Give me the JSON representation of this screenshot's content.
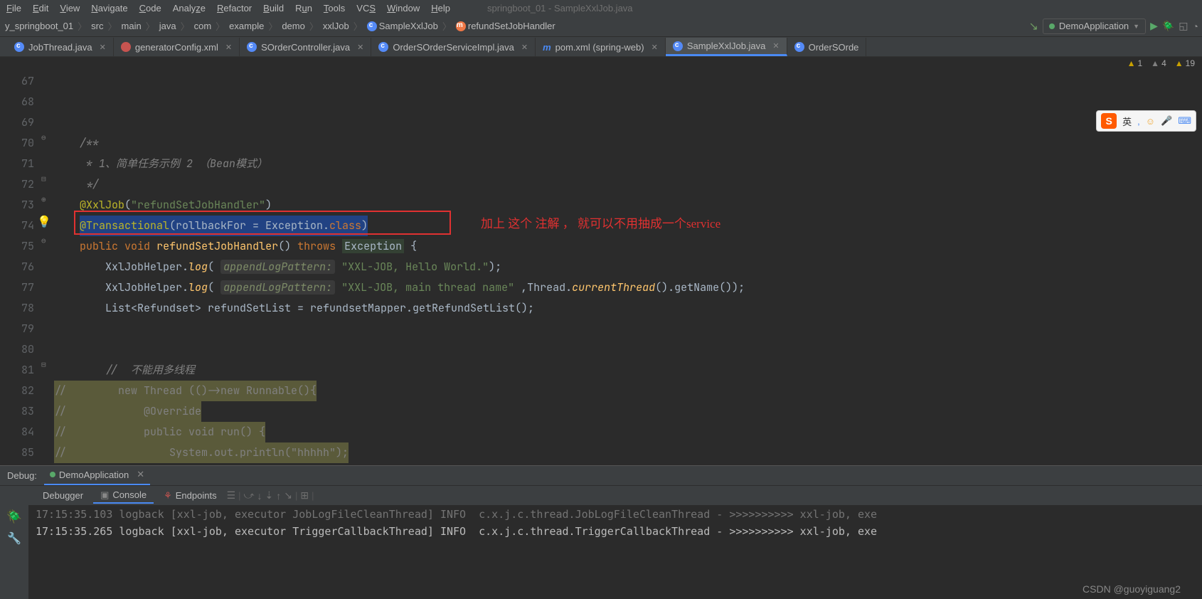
{
  "window_title": "springboot_01 - SampleXxlJob.java",
  "menu": [
    "File",
    "Edit",
    "View",
    "Navigate",
    "Code",
    "Analyze",
    "Refactor",
    "Build",
    "Run",
    "Tools",
    "VCS",
    "Window",
    "Help"
  ],
  "breadcrumbs": [
    "y_springboot_01",
    "src",
    "main",
    "java",
    "com",
    "example",
    "demo",
    "xxlJob",
    "SampleXxlJob",
    "refundSetJobHandler"
  ],
  "run_config": "DemoApplication",
  "tabs": [
    {
      "label": "JobThread.java",
      "type": "c",
      "active": false
    },
    {
      "label": "generatorConfig.xml",
      "type": "orange",
      "active": false
    },
    {
      "label": "SOrderController.java",
      "type": "c",
      "active": false
    },
    {
      "label": "OrderSOrderServiceImpl.java",
      "type": "c",
      "active": false
    },
    {
      "label": "pom.xml (spring-web)",
      "type": "m",
      "active": false
    },
    {
      "label": "SampleXxlJob.java",
      "type": "c",
      "active": true
    },
    {
      "label": "OrderSOrde",
      "type": "c",
      "active": false
    }
  ],
  "warnings": {
    "err": "1",
    "gray": "4",
    "yel": "19"
  },
  "lines_start": 67,
  "code": {
    "l70": "/**",
    "l71a": " * 1、简单任务示例 2 （Bean模式）",
    "l72": " */",
    "l73a": "@XxlJob",
    "l73b": "(\"refundSetJobHandler\")",
    "l74a": "@Transactional",
    "l74b": "(rollbackFor = Exception.",
    "l74c": "class",
    "l74d": ")",
    "l75a": "public",
    "l75b": "void",
    "l75c": "refundSetJobHandler",
    "l75d": "() ",
    "l75e": "throws",
    "l75f": "Exception",
    "l75g": " {",
    "l76a": "XxlJobHelper.",
    "l76b": "log",
    "l76c": "( ",
    "l76p": "appendLogPattern:",
    "l76d": " \"XXL-JOB, Hello World.\"",
    "l76e": ");",
    "l77a": "XxlJobHelper.",
    "l77b": "log",
    "l77c": "( ",
    "l77p": "appendLogPattern:",
    "l77d": " \"XXL-JOB, main thread name\" ",
    "l77e": ",Thread.",
    "l77f": "currentThread",
    "l77g": "().getName());",
    "l78": "List<Refundset> refundSetList = refundsetMapper.getRefundSetList();",
    "l81": "//  不能用多线程",
    "l82": "//        new Thread (()->new Runnable(){",
    "l83": "//            @Override",
    "l84": "//            public void run() {",
    "l85": "//                System.out.println(\"hhhhh\");"
  },
  "red_annotation": "加上 这个 注解 ， 就可以不用抽成一个service",
  "ime": {
    "lang": "英",
    "comma": ","
  },
  "debug": {
    "title": "Debug:",
    "app": "DemoApplication",
    "tabs": [
      "Debugger",
      "Console",
      "Endpoints"
    ]
  },
  "console_lines": [
    "17:15:35.103 logback [xxl-job, executor JobLogFileCleanThread] INFO  c.x.j.c.thread.JobLogFileCleanThread - >>>>>>>>>> xxl-job, exe",
    "17:15:35.265 logback [xxl-job, executor TriggerCallbackThread] INFO  c.x.j.c.thread.TriggerCallbackThread - >>>>>>>>>> xxl-job, exe"
  ],
  "watermark": "CSDN @guoyiguang2"
}
